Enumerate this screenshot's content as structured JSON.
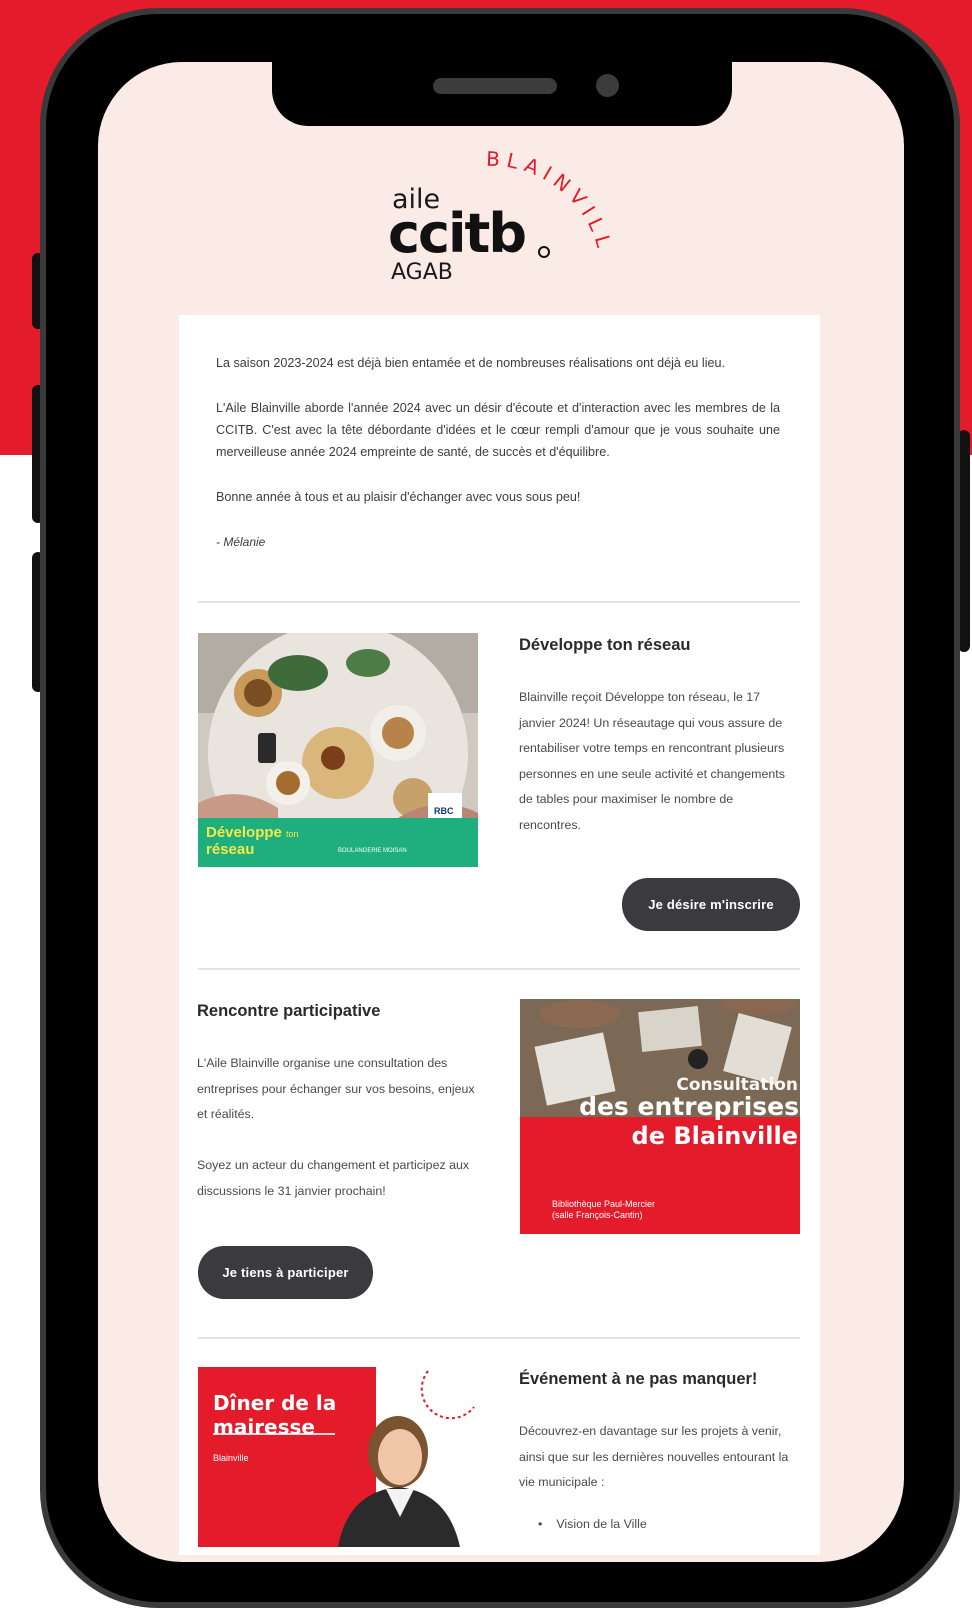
{
  "logo": {
    "aile": "aile",
    "ccitb": "ccitb",
    "agab": "AGAB",
    "arc_text": "BLAINVILLE"
  },
  "intro": {
    "p1": "La saison 2023-2024 est déjà bien entamée et de nombreuses réalisations ont déjà eu lieu.",
    "p2": "L'Aile Blainville aborde l'année 2024 avec un désir d'écoute et d'interaction avec les membres de la CCITB. C'est avec la tête débordante d'idées et le cœur rempli d'amour que je vous souhaite une merveilleuse année 2024 empreinte de santé, de succès et d'équilibre.",
    "p3": "Bonne année à tous et au plaisir d'échanger avec vous sous peu!",
    "signature": "- Mélanie"
  },
  "section1": {
    "title": "Développe ton réseau",
    "body": "Blainville reçoit Développe ton réseau, le 17 janvier 2024! Un réseautage qui vous assure de rentabiliser votre temps en rencontrant plusieurs personnes en une seule activité et changements de tables pour maximiser le nombre de rencontres.",
    "button": "Je désire m'inscrire",
    "image_banner_line1": "Développe",
    "image_banner_small": "ton",
    "image_banner_line2": "réseau",
    "image_sponsor": "BOULANGERIE MOISAN",
    "image_logo": "RBC"
  },
  "section2": {
    "title": "Rencontre participative",
    "body1": "L'Aile Blainville organise une consultation des entreprises pour échanger sur vos besoins, enjeux et réalités.",
    "body2": "Soyez un acteur du changement et participez aux discussions le 31 janvier prochain!",
    "button": "Je tiens à participer",
    "image_line1": "Consultation",
    "image_line2": "des entreprises",
    "image_line3": "de Blainville",
    "image_place1": "Bibliothèque Paul-Mercier",
    "image_place2": "(salle François-Cantin)"
  },
  "section3": {
    "title": "Événement à ne pas manquer!",
    "body": "Découvrez-en davantage sur les projets à venir, ainsi que sur les dernières nouvelles entourant la vie municipale :",
    "bullet1": "Vision de la Ville",
    "image_title1": "Dîner de la",
    "image_title2": "mairesse",
    "image_sub": "Blainville"
  },
  "colors": {
    "brand_red": "#e31b2b",
    "screen_bg": "#fbebe7",
    "button_bg": "#3b3b3f",
    "banner_green": "#1fae7e"
  }
}
